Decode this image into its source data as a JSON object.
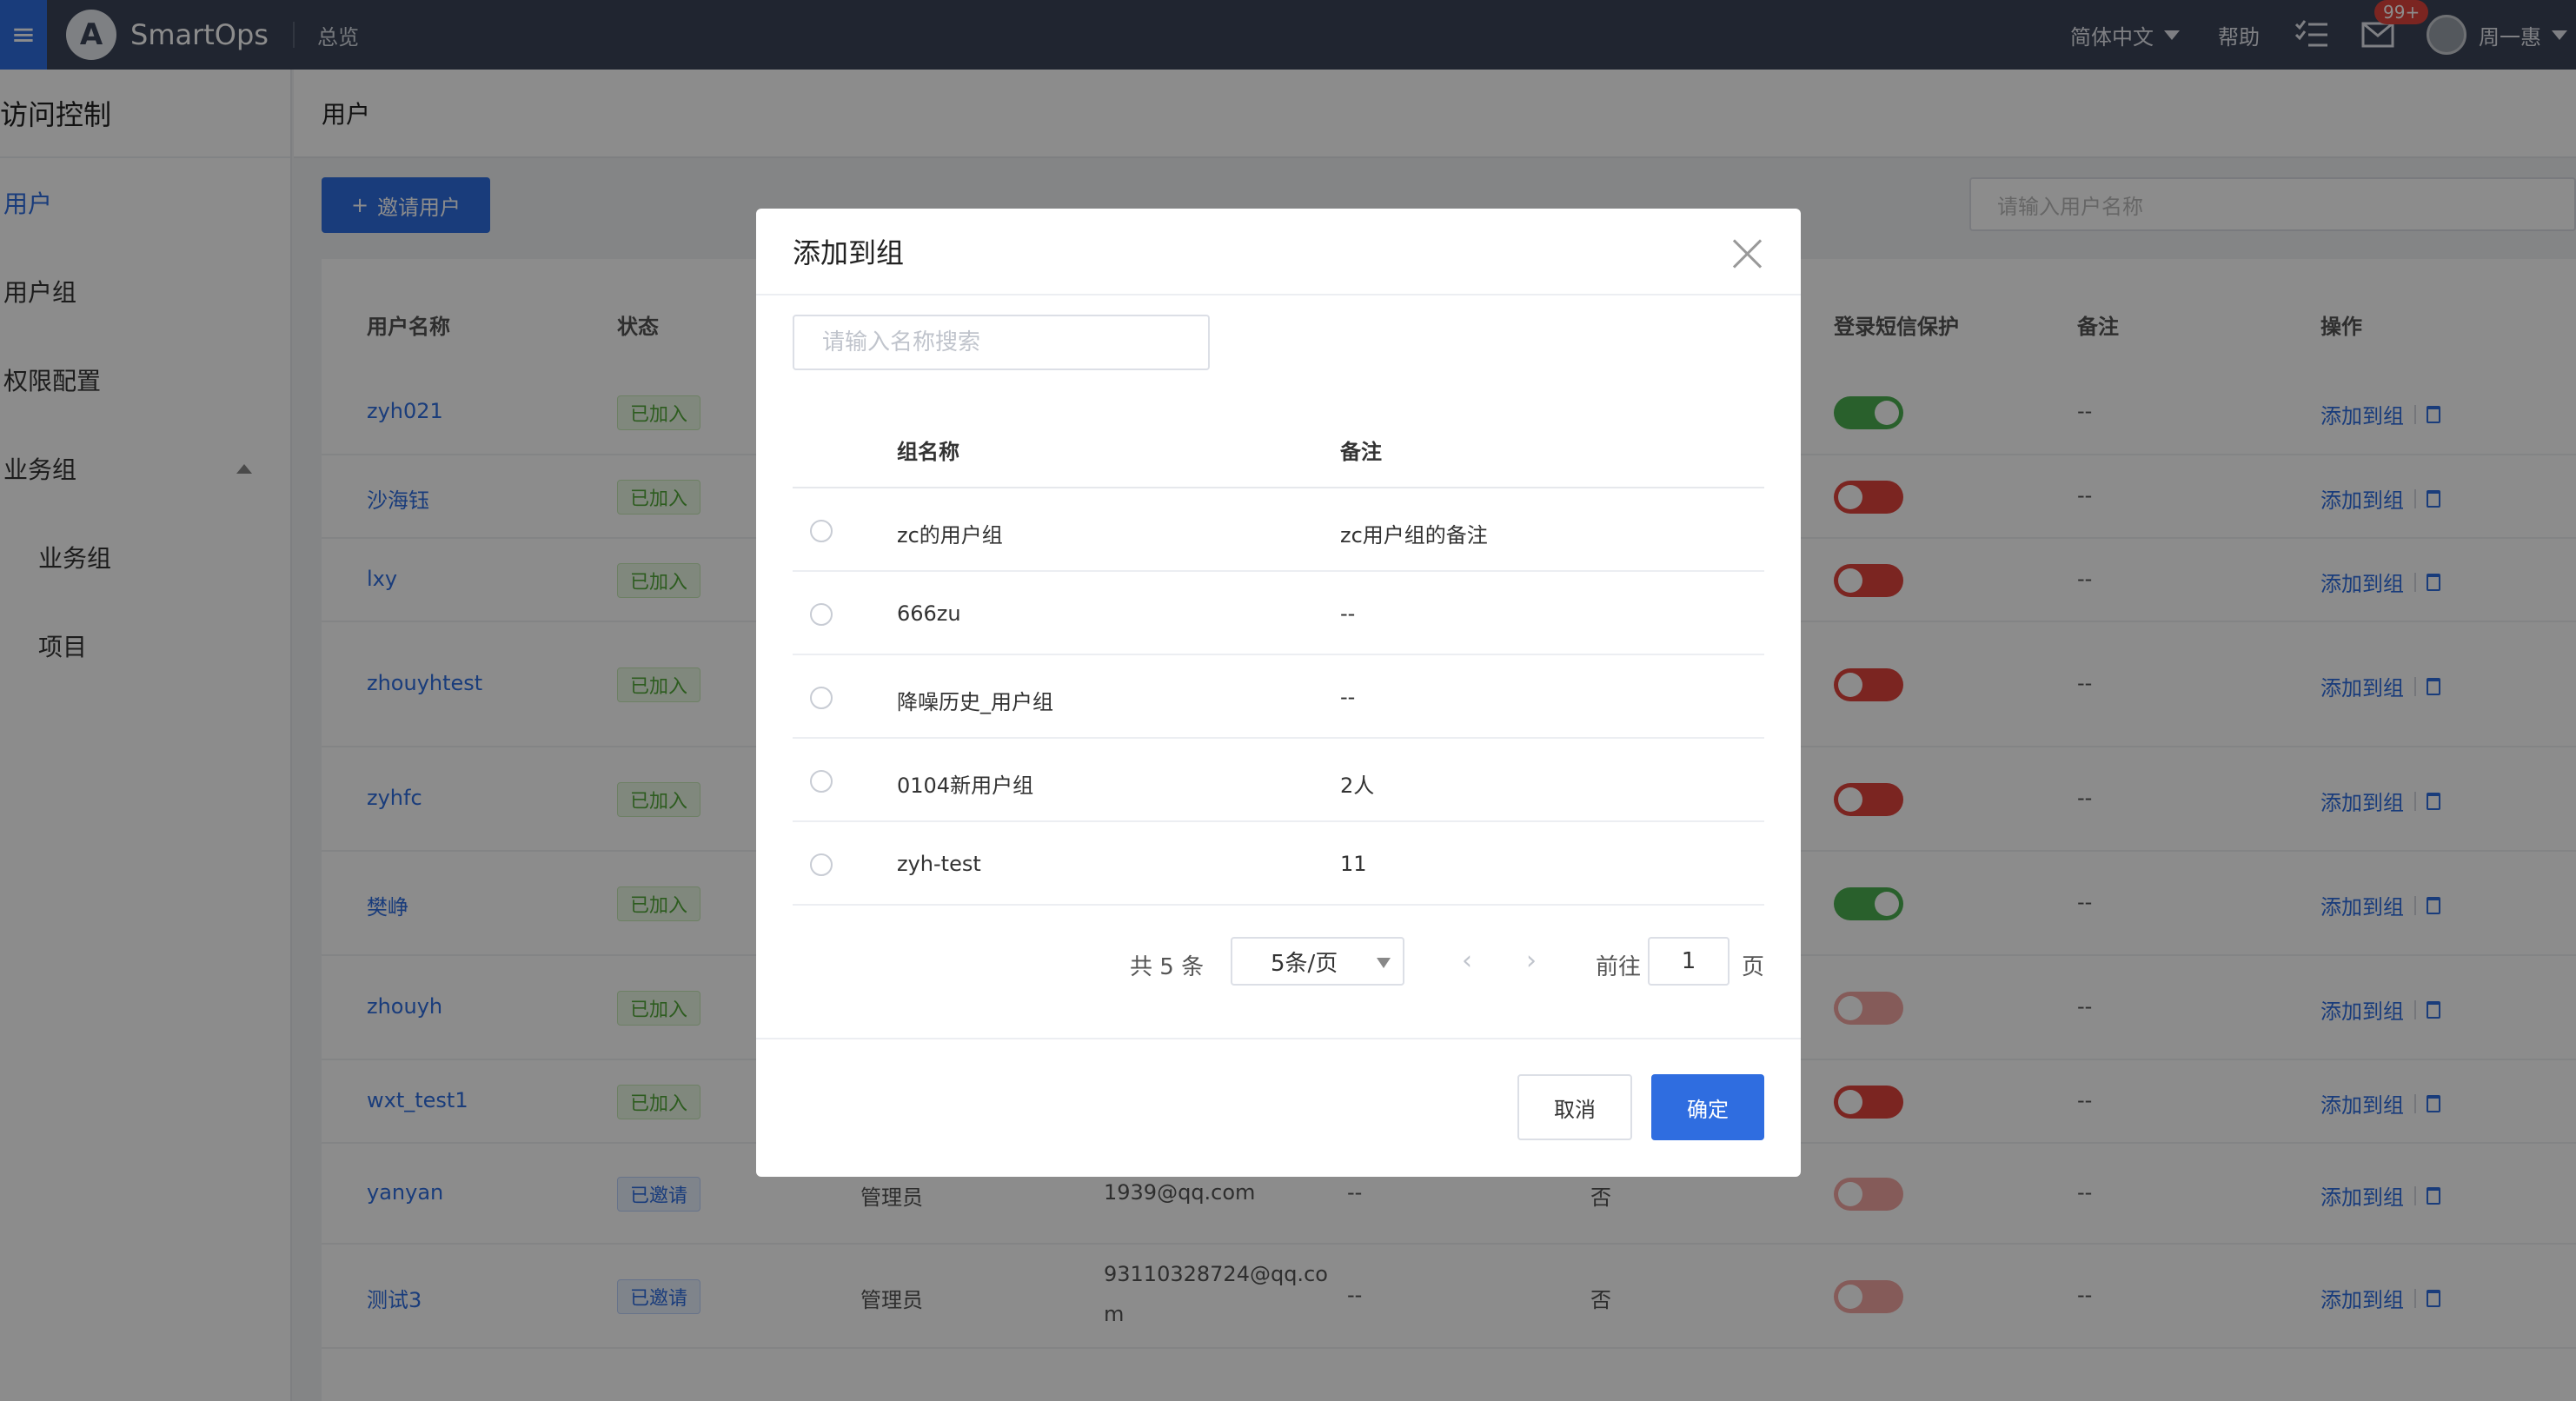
{
  "topbar": {
    "brand": "SmartOps",
    "overview": "总览",
    "language": "简体中文",
    "help": "帮助",
    "badge": "99+",
    "username": "周一惠"
  },
  "sidebar": {
    "title": "访问控制",
    "items": [
      {
        "label": "用户",
        "active": true
      },
      {
        "label": "用户组"
      },
      {
        "label": "权限配置"
      },
      {
        "label": "业务组",
        "expanded": true
      },
      {
        "label": "业务组",
        "sub": true
      },
      {
        "label": "项目",
        "sub": true
      }
    ]
  },
  "page": {
    "title": "用户",
    "invite_label": "邀请用户",
    "search_placeholder": "请输入用户名称"
  },
  "table": {
    "headers": {
      "name": "用户名称",
      "status": "状态",
      "sms": "登录短信保护",
      "note": "备注",
      "ops": "操作"
    },
    "add_to_group": "添加到组",
    "rows": [
      {
        "name": "zyh021",
        "status": "已加入",
        "status_type": "joined",
        "sms": "on",
        "note": "--"
      },
      {
        "name": "沙海钰",
        "status": "已加入",
        "status_type": "joined",
        "sms": "off",
        "note": "--"
      },
      {
        "name": "lxy",
        "status": "已加入",
        "status_type": "joined",
        "sms": "off",
        "note": "--"
      },
      {
        "name": "zhouyhtest",
        "status": "已加入",
        "status_type": "joined",
        "sms": "off",
        "note": "--"
      },
      {
        "name": "zyhfc",
        "status": "已加入",
        "status_type": "joined",
        "sms": "off",
        "note": "--"
      },
      {
        "name": "樊峥",
        "status": "已加入",
        "status_type": "joined",
        "sms": "on",
        "note": "--"
      },
      {
        "name": "zhouyh",
        "status": "已加入",
        "status_type": "joined",
        "sms": "faint",
        "note": "--"
      },
      {
        "name": "wxt_test1",
        "status": "已加入",
        "status_type": "joined",
        "sms": "off",
        "note": "--"
      },
      {
        "name": "yanyan",
        "status": "已邀请",
        "status_type": "invited",
        "role": "管理员",
        "email": "1939@qq.com",
        "col5": "--",
        "col6": "否",
        "sms": "faint",
        "note": "--"
      },
      {
        "name": "测试3",
        "status": "已邀请",
        "status_type": "invited",
        "role": "管理员",
        "email_line1": "93110328724@qq.co",
        "email_line2": "m",
        "col5": "--",
        "col6": "否",
        "sms": "faint",
        "note": "--"
      }
    ]
  },
  "modal": {
    "title": "添加到组",
    "search_placeholder": "请输入名称搜索",
    "headers": {
      "name": "组名称",
      "note": "备注"
    },
    "groups": [
      {
        "name": "zc的用户组",
        "note": "zc用户组的备注"
      },
      {
        "name": "666zu",
        "note": "--"
      },
      {
        "name": "降噪历史_用户组",
        "note": "--"
      },
      {
        "name": "0104新用户组",
        "note": "2人"
      },
      {
        "name": "zyh-test",
        "note": "11"
      }
    ],
    "pagination": {
      "total": "共 5 条",
      "page_size": "5条/页",
      "goto_label": "前往",
      "current_page": "1",
      "page_suffix": "页"
    },
    "cancel_label": "取消",
    "confirm_label": "确定"
  }
}
